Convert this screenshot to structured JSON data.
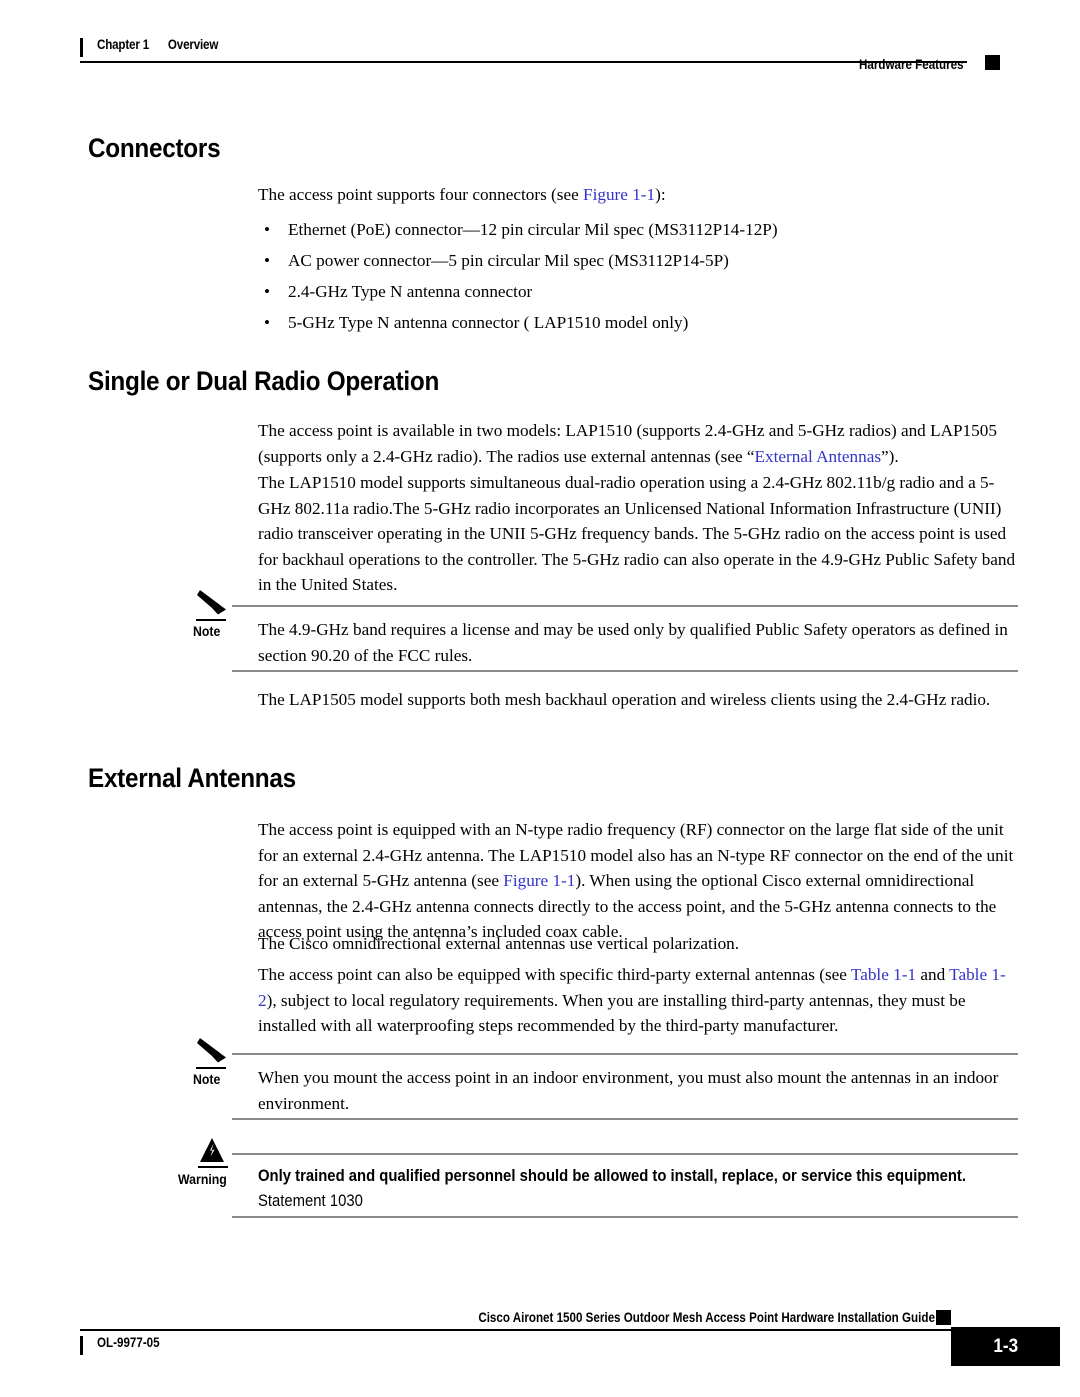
{
  "header": {
    "chapter_number": "Chapter 1",
    "chapter_title": "Overview",
    "running_head": "Hardware Features"
  },
  "sections": [
    {
      "id": "connectors",
      "heading": "Connectors",
      "intro_before_link": "The access point supports four connectors (see ",
      "intro_link": "Figure 1-1",
      "intro_after_link": "):",
      "bullet_glyph": "•",
      "bullets": [
        "Ethernet (PoE) connector—12 pin circular Mil spec (MS3112P14-12P)",
        "AC power connector—5 pin circular Mil spec (MS3112P14-5P)",
        "2.4-GHz Type N antenna connector",
        "5-GHz Type N antenna connector ( LAP1510 model only)"
      ]
    },
    {
      "id": "single-or-dual-radio-operation",
      "heading": "Single or Dual Radio Operation",
      "para1_a": "The access point is available in two models: LAP1510 (supports 2.4-GHz and 5-GHz radios) and LAP1505 (supports only a 2.4-GHz radio). The radios use external antennas (see “",
      "para1_link": "External Antennas",
      "para1_b": "”).",
      "para2": "The LAP1510 model supports simultaneous dual-radio operation using a 2.4-GHz 802.11b/g radio and a 5-GHz 802.11a radio.The 5-GHz radio incorporates an Unlicensed National Information Infrastructure (UNII) radio transceiver operating in the UNII 5-GHz frequency bands. The 5-GHz radio on the access point is used for backhaul operations to the controller. The 5-GHz radio can also operate in the 4.9-GHz Public Safety band in the United States.",
      "note1_label": "Note",
      "note1_text": "The 4.9-GHz band requires a license and may be used only by qualified Public Safety operators as defined in section 90.20 of the FCC rules.",
      "para3": "The LAP1505 model supports both mesh backhaul operation and wireless clients using the 2.4-GHz radio."
    },
    {
      "id": "external-antennas",
      "heading": "External Antennas",
      "para1_a": "The access point is equipped with an N-type radio frequency (RF) connector on the large flat side of the unit for an external 2.4-GHz antenna. The LAP1510 model also has an N-type RF connector on the end of the unit for an external 5-GHz antenna (see ",
      "para1_link": "Figure 1-1",
      "para1_b": "). When using the optional Cisco external omnidirectional antennas, the 2.4-GHz antenna connects directly to the access point, and the 5-GHz antenna connects to the access point using the antenna’s included coax cable.",
      "para2": "The Cisco omnidirectional external antennas use vertical polarization.",
      "para3_a": "The access point can also be equipped with specific third-party external antennas (see ",
      "para3_link1": "Table 1-1",
      "para3_mid": " and ",
      "para3_link2": "Table 1-2",
      "para3_b": "), subject to local regulatory requirements. When you are installing third-party antennas, they must be installed with all waterproofing steps recommended by the third-party manufacturer.",
      "note2_label": "Note",
      "note2_text": "When you mount the access point in an indoor environment, you must also mount the antennas in an indoor environment.",
      "warning_label": "Warning",
      "warning_text": "Only trained and qualified personnel should be allowed to install, replace, or service this equipment.",
      "warning_statement": "Statement 1030"
    }
  ],
  "footer": {
    "guide_title": "Cisco Aironet 1500 Series Outdoor Mesh Access Point Hardware Installation Guide",
    "document_id": "OL-9977-05",
    "page_number": "1-3"
  },
  "colors": {
    "link": "#3333cc",
    "text": "#000000",
    "rule": "#8a8a8a",
    "page_box": "#000000"
  }
}
